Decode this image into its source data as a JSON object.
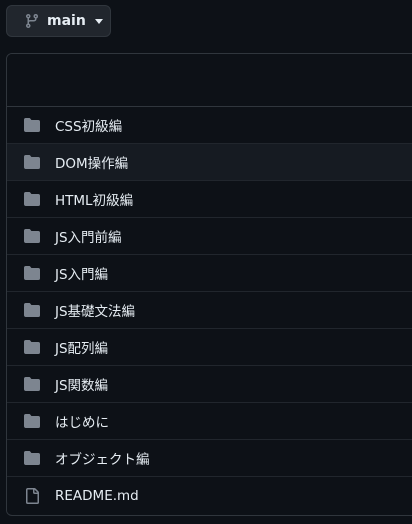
{
  "branch": {
    "name": "main",
    "icon": "git-branch-icon"
  },
  "files": [
    {
      "name": "CSS初級編",
      "type": "folder"
    },
    {
      "name": "DOM操作編",
      "type": "folder"
    },
    {
      "name": "HTML初級編",
      "type": "folder"
    },
    {
      "name": "JS入門前編",
      "type": "folder"
    },
    {
      "name": "JS入門編",
      "type": "folder"
    },
    {
      "name": "JS基礎文法編",
      "type": "folder"
    },
    {
      "name": "JS配列編",
      "type": "folder"
    },
    {
      "name": "JS関数編",
      "type": "folder"
    },
    {
      "name": "はじめに",
      "type": "folder"
    },
    {
      "name": "オブジェクト編",
      "type": "folder"
    },
    {
      "name": "README.md",
      "type": "file"
    }
  ],
  "colors": {
    "folder": "#7d8590",
    "file": "#7d8590",
    "text": "#e6edf3",
    "border": "#30363d",
    "background": "#0d1117"
  }
}
